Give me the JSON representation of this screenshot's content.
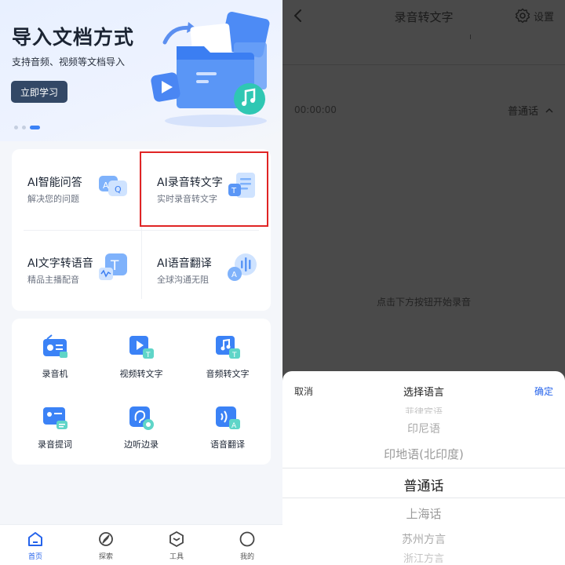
{
  "left": {
    "banner": {
      "title": "导入文档方式",
      "subtitle": "支持音频、视频等文档导入",
      "button_label": "立即学习"
    },
    "ai_cards": [
      {
        "title": "AI智能问答",
        "subtitle": "解决您的问题",
        "icon": "ai-qa-icon"
      },
      {
        "title": "AI录音转文字",
        "subtitle": "实时录音转文字",
        "icon": "record-to-text-icon"
      },
      {
        "title": "AI文字转语音",
        "subtitle": "精品主播配音",
        "icon": "text-to-speech-icon"
      },
      {
        "title": "AI语音翻译",
        "subtitle": "全球沟通无阻",
        "icon": "voice-translate-icon"
      }
    ],
    "tools": [
      {
        "label": "录音机",
        "icon": "radio-icon"
      },
      {
        "label": "视频转文字",
        "icon": "video-to-text-icon"
      },
      {
        "label": "音频转文字",
        "icon": "audio-to-text-icon"
      },
      {
        "label": "录音提词",
        "icon": "teleprompter-icon"
      },
      {
        "label": "边听边录",
        "icon": "listen-record-icon"
      },
      {
        "label": "语音翻译",
        "icon": "voice-translation-icon"
      }
    ],
    "nav": [
      {
        "label": "首页",
        "icon": "home-icon",
        "active": true
      },
      {
        "label": "探索",
        "icon": "compass-icon",
        "active": false
      },
      {
        "label": "工具",
        "icon": "toolbox-icon",
        "active": false
      },
      {
        "label": "我的",
        "icon": "profile-icon",
        "active": false
      }
    ]
  },
  "right": {
    "header": {
      "title": "录音转文字",
      "settings_label": "设置"
    },
    "time": "00:00:00",
    "language": "普通话",
    "hint": "点击下方按钮开始录音",
    "sheet": {
      "cancel": "取消",
      "title": "选择语言",
      "confirm": "确定",
      "options": [
        "菲律宾语",
        "印尼语",
        "印地语(北印度)",
        "普通话",
        "上海话",
        "苏州方言",
        "浙江方言"
      ],
      "selected": "普通话"
    }
  },
  "colors": {
    "accent": "#2563eb",
    "dark_button": "#334866",
    "highlight": "#e02424"
  }
}
